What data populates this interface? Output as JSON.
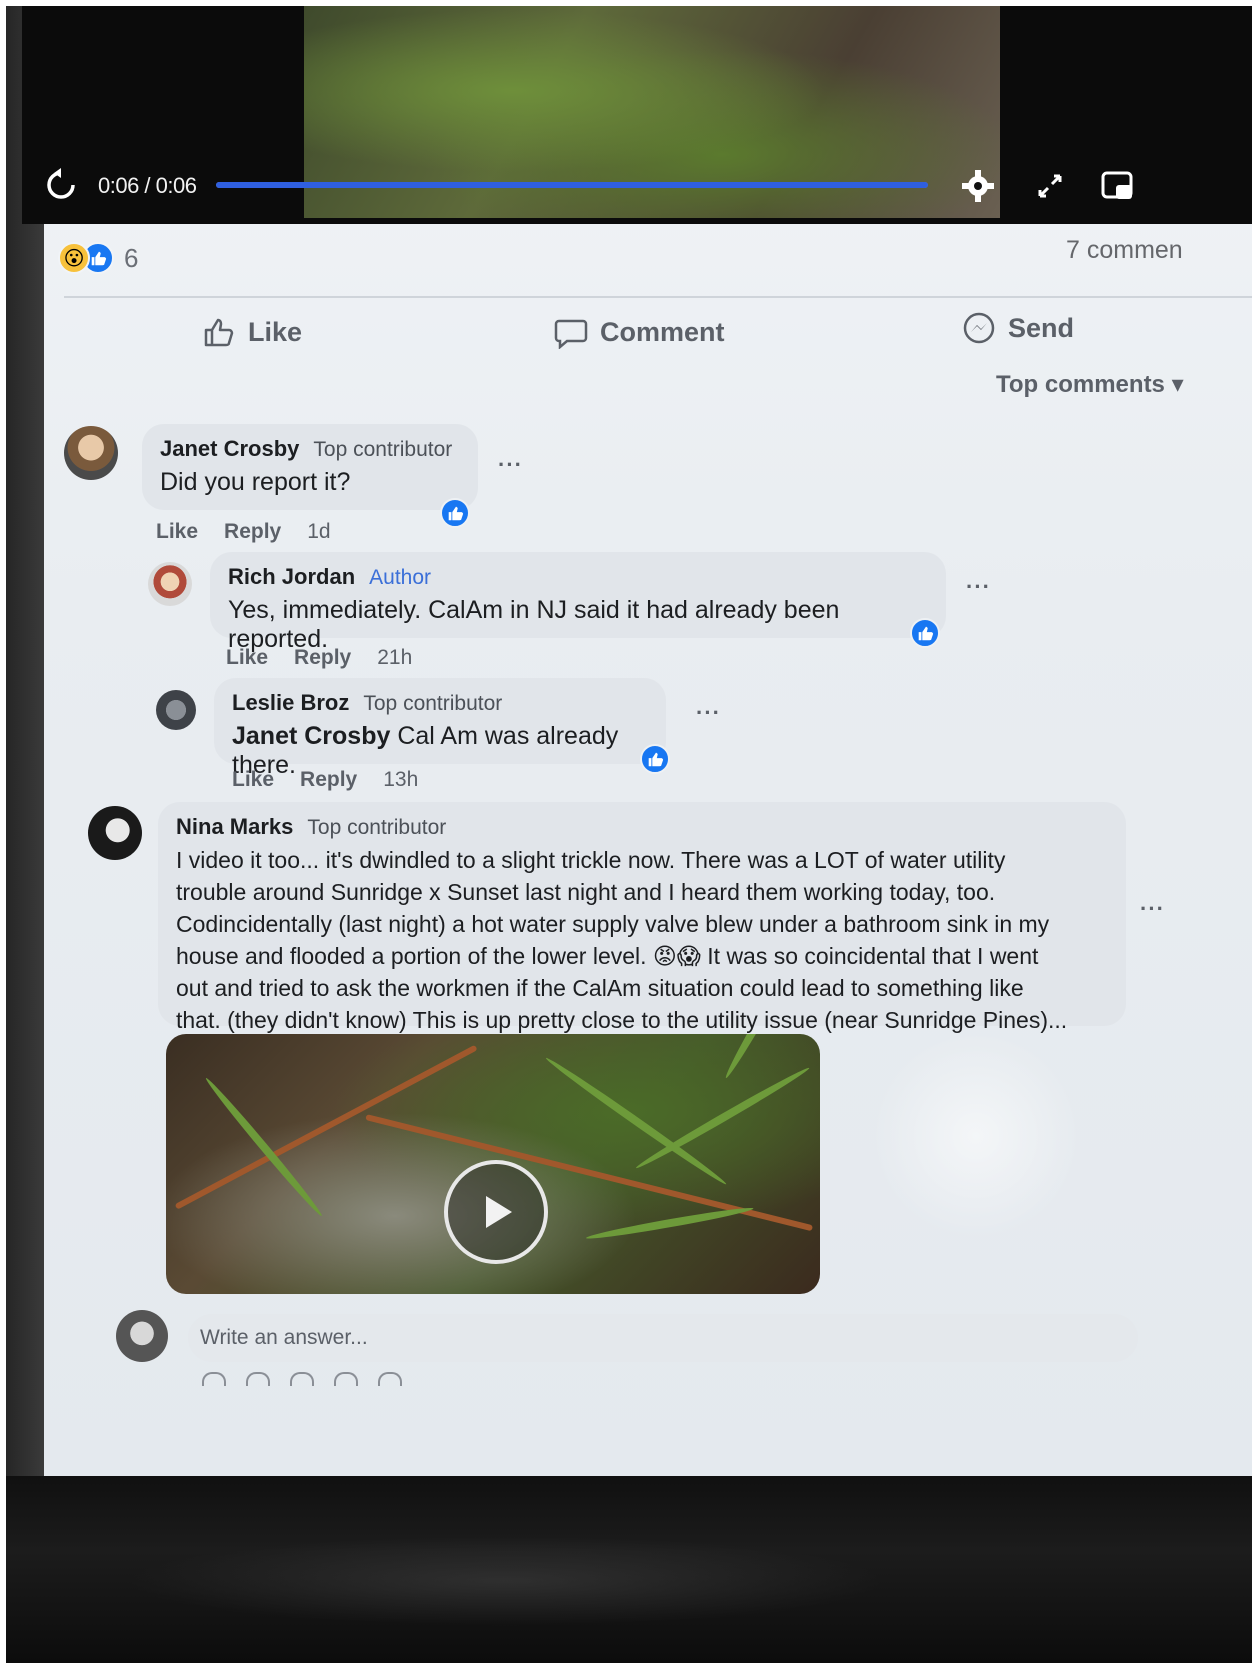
{
  "video": {
    "time": "0:06 / 0:06",
    "progress": 1.0,
    "accent": "#2f5fe0"
  },
  "post": {
    "reaction_count": "6",
    "comments_count": "7 commen",
    "actions": {
      "like": "Like",
      "comment": "Comment",
      "send": "Send"
    },
    "sort": "Top comments"
  },
  "comments": [
    {
      "author": "Janet Crosby",
      "badge": "Top contributor",
      "text": "Did you report it?",
      "like": "Like",
      "reply": "Reply",
      "time": "1d"
    },
    {
      "author": "Rich Jordan",
      "badge": "Author",
      "text": "Yes, immediately. CalAm in NJ said it had already been reported.",
      "like": "Like",
      "reply": "Reply",
      "time": "21h"
    },
    {
      "author": "Leslie Broz",
      "badge": "Top contributor",
      "mention": "Janet Crosby",
      "text": " Cal Am was already there.",
      "like": "Like",
      "reply": "Reply",
      "time": "13h"
    },
    {
      "author": "Nina Marks",
      "badge": "Top contributor",
      "lines": [
        "I video it too... it's dwindled to a slight trickle now. There was a LOT of water utility",
        "trouble around Sunridge x Sunset last night and I heard them working today, too.",
        "Codincidentally (last night) a hot water supply valve blew under a bathroom sink in my",
        "house and flooded a portion of the lower level. 😡😱 It was so coincidental that I went",
        "out and tried to ask the workmen if the CalAm situation could lead to something like",
        "that. (they didn't know) This is up pretty close to the utility issue (near Sunridge Pines)..."
      ]
    }
  ],
  "composer": {
    "placeholder": "Write an answer..."
  },
  "icons": {
    "replay": "replay-icon",
    "settings": "gear-icon",
    "fullscreen": "expand-icon",
    "pip": "picture-in-picture-icon",
    "like": "thumbs-up-icon",
    "comment": "speech-bubble-icon",
    "send": "messenger-icon",
    "play": "play-icon"
  },
  "colors": {
    "facebook_blue": "#1877f2",
    "author_badge": "#3b6fd8"
  }
}
